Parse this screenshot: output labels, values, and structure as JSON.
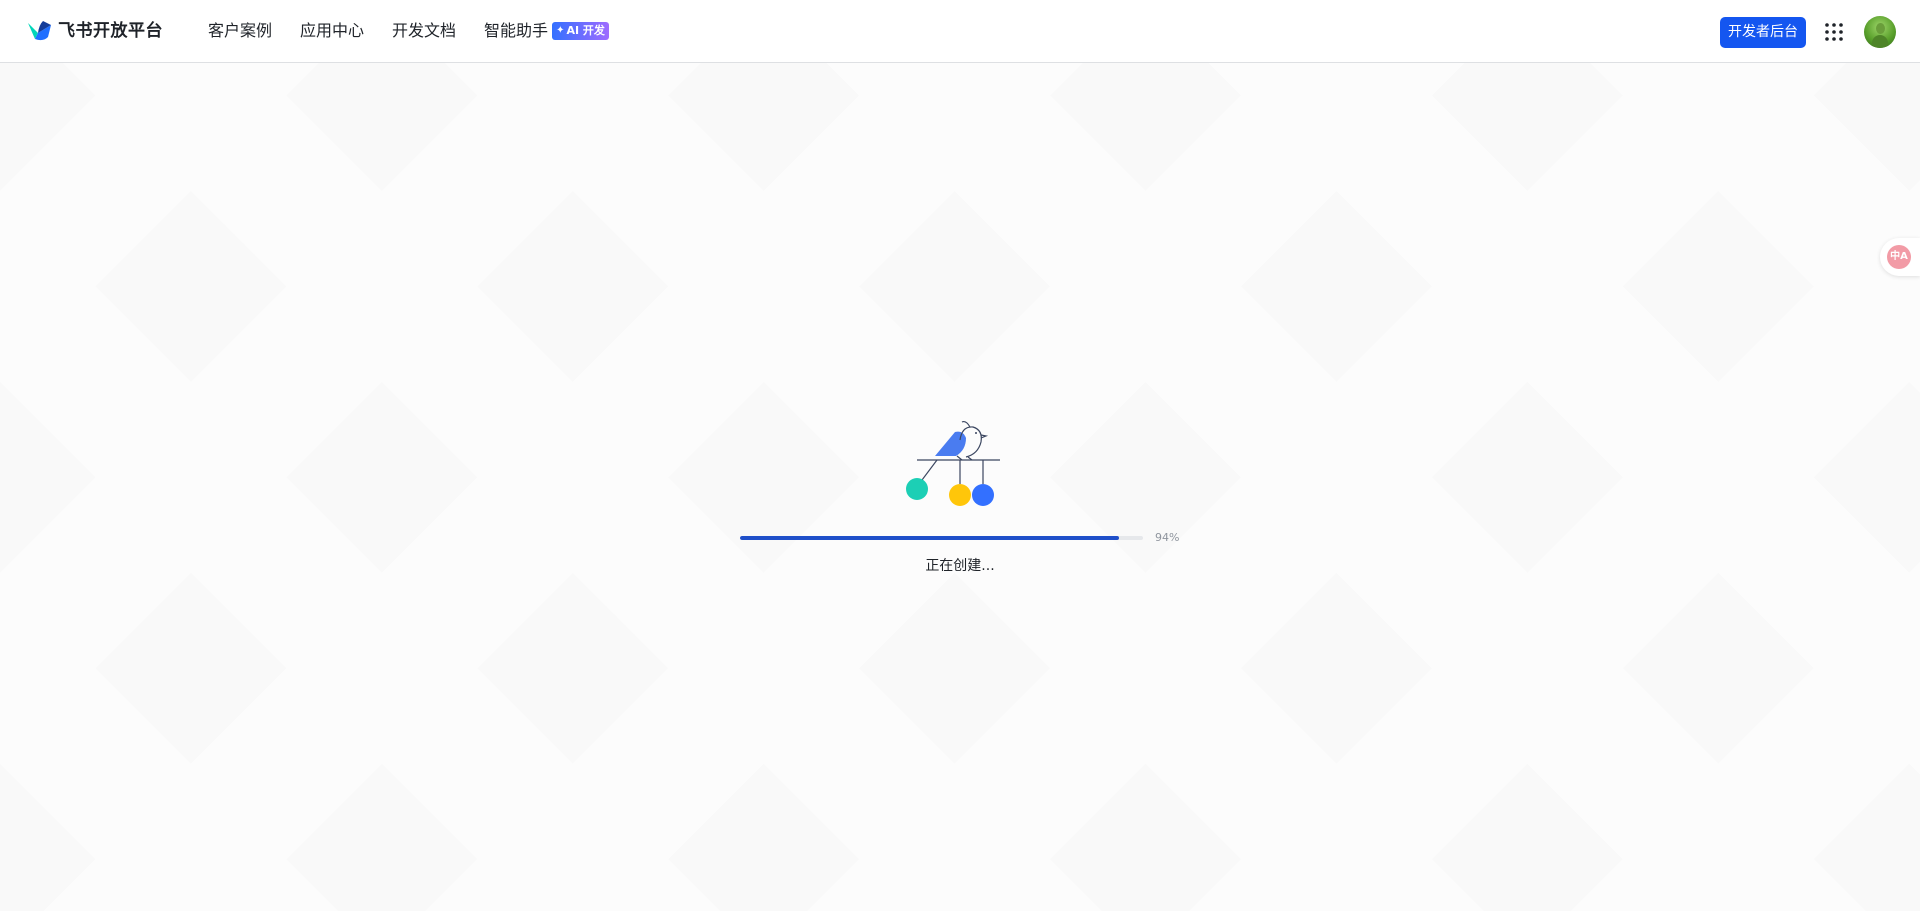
{
  "header": {
    "brand": "飞书开放平台",
    "nav": [
      {
        "label": "客户案例"
      },
      {
        "label": "应用中心"
      },
      {
        "label": "开发文档"
      },
      {
        "label": "智能助手"
      }
    ],
    "ai_badge": {
      "icon": "sparkle-icon",
      "label": "AI 开发"
    },
    "dev_console_label": "开发者后台",
    "apps_icon": "grid-dots-icon",
    "avatar_icon": "user-avatar"
  },
  "translate_widget": {
    "icon": "translate-icon",
    "glyph": "中A"
  },
  "loading": {
    "progress": 0.94,
    "progress_label": "94%",
    "status": "正在创建..."
  },
  "colors": {
    "primary": "#1456f0",
    "progress": "#1f4fc9",
    "ball_teal": "#1ccfb5",
    "ball_yellow": "#ffc60a",
    "ball_blue": "#3370ff",
    "bird": "#4a7cf0"
  }
}
